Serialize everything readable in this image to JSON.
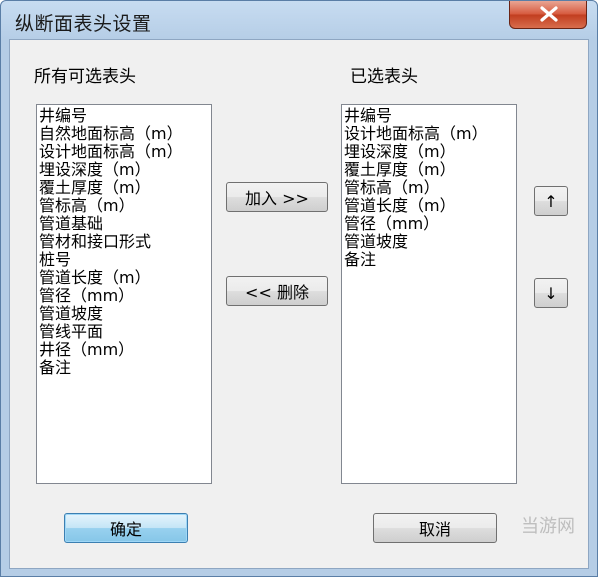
{
  "window": {
    "title": "纵断面表头设置"
  },
  "labels": {
    "available": "所有可选表头",
    "selected": "已选表头"
  },
  "available_items": [
    "井编号",
    "自然地面标高（m）",
    "设计地面标高（m）",
    "埋设深度（m）",
    "覆土厚度（m）",
    "管标高（m）",
    "管道基础",
    "管材和接口形式",
    "桩号",
    "管道长度（m）",
    "管径（mm）",
    "管道坡度",
    "管线平面",
    "井径（mm）",
    "备注"
  ],
  "selected_items": [
    "井编号",
    "设计地面标高（m）",
    "埋设深度（m）",
    "覆土厚度（m）",
    "管标高（m）",
    "管道长度（m）",
    "管径（mm）",
    "管道坡度",
    "备注"
  ],
  "buttons": {
    "add": "加入 >>",
    "remove": "<< 删除",
    "up": "↑",
    "down": "↓",
    "ok": "确定",
    "cancel": "取消"
  },
  "watermark": "当游网",
  "icons": {
    "close": "close-icon"
  }
}
